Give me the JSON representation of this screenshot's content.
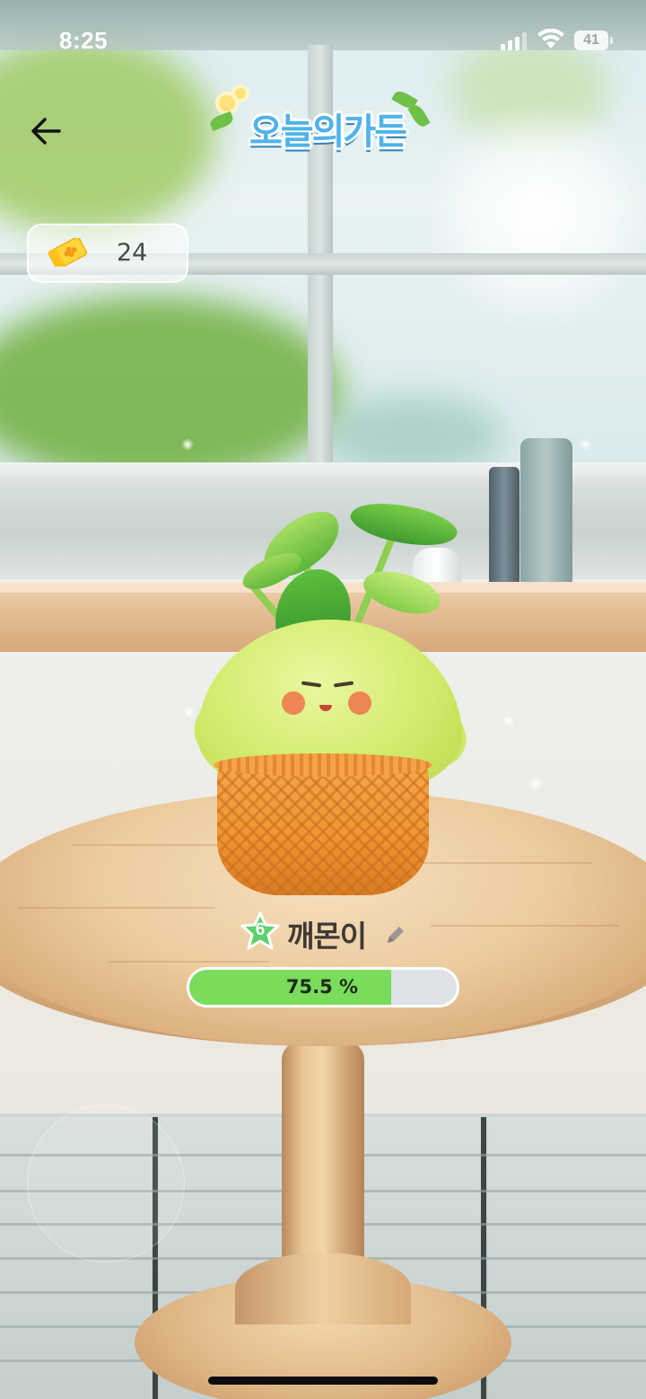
{
  "status_bar": {
    "time": "8:25",
    "battery": "41"
  },
  "header": {
    "logo_text": "오늘의가든",
    "back_icon": "arrow-left-icon"
  },
  "currency": {
    "icon": "clover-ticket-icon",
    "count": "24"
  },
  "plant": {
    "level": "6",
    "name": "깨몬이",
    "edit_icon": "pencil-icon",
    "growth_percent_value": 75.5,
    "growth_label": "75.5 %"
  },
  "colors": {
    "progress_fill": "#79dc5a",
    "progress_track": "#dfe3e6",
    "level_star": "#5fd16c",
    "logo_blue": "#4fb3ea"
  }
}
